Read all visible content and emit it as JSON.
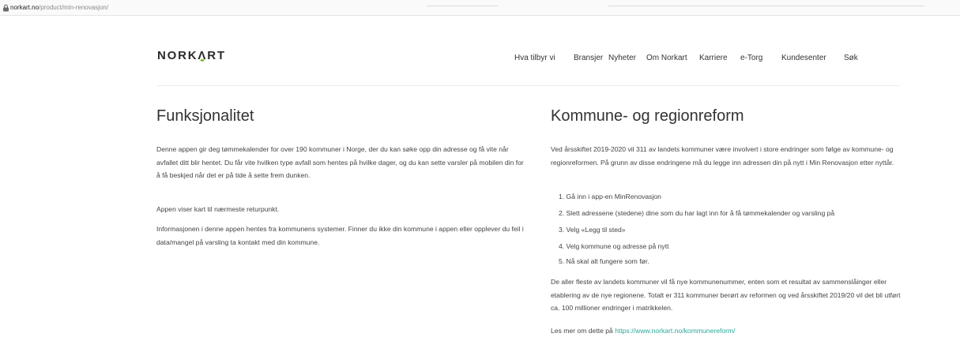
{
  "browser": {
    "url_host": "norkart.no",
    "url_path": "/product/min-renovasjon/"
  },
  "header": {
    "logo_text": {
      "before": "NORK",
      "a_char": "Λ",
      "after": "RT"
    },
    "nav": [
      {
        "label": "Hva tilbyr vi"
      },
      {
        "label": "Bransjer"
      },
      {
        "label": "Nyheter"
      },
      {
        "label": "Om Norkart"
      },
      {
        "label": "Karriere"
      },
      {
        "label": "e-Torg"
      },
      {
        "label": "Kundesenter"
      },
      {
        "label": "Søk"
      }
    ]
  },
  "left": {
    "title": "Funksjonalitet",
    "paragraphs": [
      "Denne appen gir deg tømmekalender for over 190 kommuner i Norge, der du kan søke opp din adresse og få vite når avfallet ditt blir hentet. Du får vite hvilken type avfall som hentes på hvilke dager, og du kan sette varsler på mobilen din for å få beskjed når det er på tide å sette frem dunken.",
      "Appen viser kart til nærmeste returpunkt.",
      "Informasjonen i denne appen hentes fra kommunens systemer. Finner du ikke din kommune i appen eller opplever du feil i data/mangel på varsling ta kontakt med din kommune."
    ]
  },
  "right": {
    "title": "Kommune- og regionreform",
    "intro": "Ved årsskiftet 2019-2020 vil 311 av landets kommuner være involvert i store endringer som følge av kommune- og regionreformen. På grunn av disse endringene må du legge inn adressen din på nytt i Min Renovasjon etter nyttår.",
    "steps": [
      "1. Gå inn i app-en  MinRenovasjon",
      "2. Slett adressene (stedene) dine som du har lagt inn for å få tømmekalender og varsling på",
      "3. Velg «Legg til sted»",
      "4. Velg kommune og adresse på nytt",
      "5. Nå skal alt fungere som før."
    ],
    "outro": "De aller fleste av landets kommuner vil få nye kommunenummer, enten som et resultat av sammenslåinger eller etablering av de nye regionene. Totalt er 311 kommuner berørt av reformen og ved årsskiftet 2019/20 vil det bli utført ca. 100 millioner endringer i matrikkelen.",
    "more_prefix": "Les mer om dette på ",
    "more_link": "https://www.norkart.no/kommunereform/"
  },
  "colors": {
    "accent": "#2aa79b",
    "logo_leaf": "#7cbf3a"
  }
}
